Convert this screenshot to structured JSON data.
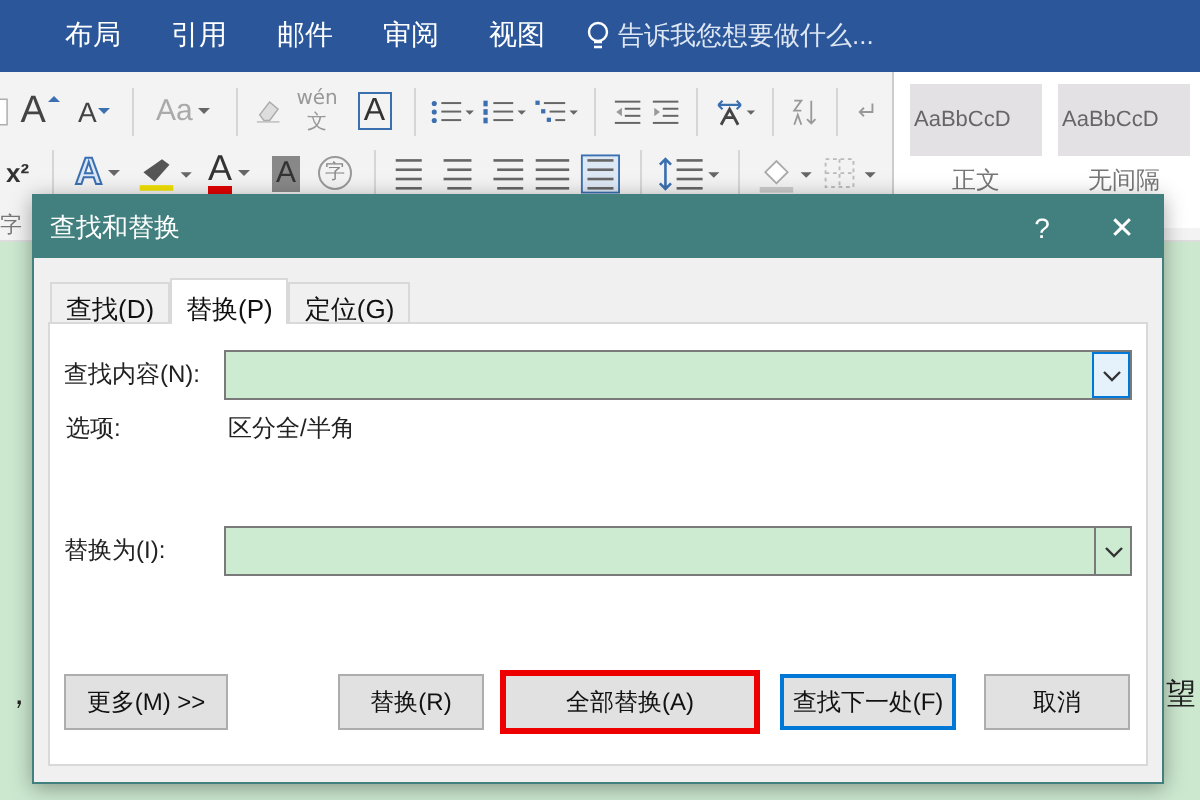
{
  "menu_tabs": [
    "布局",
    "引用",
    "邮件",
    "审阅",
    "视图"
  ],
  "tell_me": {
    "placeholder": "告诉我您想要做什么..."
  },
  "ribbon": {
    "row_1": [
      {
        "kind": "combo_edge"
      },
      {
        "kind": "glyph_up",
        "text": "A"
      },
      {
        "kind": "glyph_down",
        "text": "A"
      },
      {
        "kind": "sep"
      },
      {
        "kind": "glyph_drop",
        "text": "Aa"
      },
      {
        "kind": "sep"
      },
      {
        "kind": "eraser"
      },
      {
        "kind": "phonetic",
        "text": "wén",
        "sub": "文"
      },
      {
        "kind": "glyph_boxed",
        "text": "A"
      },
      {
        "kind": "sep"
      },
      {
        "kind": "bullets"
      },
      {
        "kind": "numbering"
      },
      {
        "kind": "multilevel"
      },
      {
        "kind": "sep"
      },
      {
        "kind": "indent_less"
      },
      {
        "kind": "indent_more"
      },
      {
        "kind": "sep"
      },
      {
        "kind": "text_dir"
      },
      {
        "kind": "sep"
      },
      {
        "kind": "sort"
      },
      {
        "kind": "sep"
      },
      {
        "kind": "pilcrow"
      }
    ],
    "row_2": [
      {
        "kind": "glyph_plain",
        "text": "x²"
      },
      {
        "kind": "sep"
      },
      {
        "kind": "glyph_outline",
        "text": "A"
      },
      {
        "kind": "highlight"
      },
      {
        "kind": "glyph_color",
        "text": "A"
      },
      {
        "kind": "glyph_shaded",
        "text": "A"
      },
      {
        "kind": "glyph_circled",
        "text": "字"
      },
      {
        "kind": "sep"
      },
      {
        "kind": "align_left"
      },
      {
        "kind": "align_center"
      },
      {
        "kind": "align_right"
      },
      {
        "kind": "justify"
      },
      {
        "kind": "distribute"
      },
      {
        "kind": "sep"
      },
      {
        "kind": "line_spacing"
      },
      {
        "kind": "sep"
      },
      {
        "kind": "shading"
      },
      {
        "kind": "borders"
      }
    ],
    "styles": [
      {
        "preview": "AaBbCcD",
        "name": "正文"
      },
      {
        "preview": "AaBbCcD",
        "name": "无间隔"
      }
    ],
    "group_label": "字"
  },
  "document": {
    "left_text": "，",
    "right_text": "望"
  },
  "dialog": {
    "title": "查找和替换",
    "help": "?",
    "close": "✕",
    "tabs": [
      {
        "label": "查找(D)",
        "selected": false
      },
      {
        "label": "替换(P)",
        "selected": true
      },
      {
        "label": "定位(G)",
        "selected": false
      }
    ],
    "find_label": "查找内容(N):",
    "options_label": "选项:",
    "options_value": "区分全/半角",
    "replace_label": "替换为(I):",
    "buttons": [
      {
        "label": "更多(M) >>",
        "kind": "left",
        "outlined": false,
        "default": false
      },
      {
        "label": "替换(R)",
        "kind": "right",
        "outlined": false,
        "default": false
      },
      {
        "label": "全部替换(A)",
        "kind": "right",
        "outlined": true,
        "default": false
      },
      {
        "label": "查找下一处(F)",
        "kind": "right",
        "outlined": false,
        "default": true
      },
      {
        "label": "取消",
        "kind": "right",
        "outlined": false,
        "default": false
      }
    ]
  }
}
